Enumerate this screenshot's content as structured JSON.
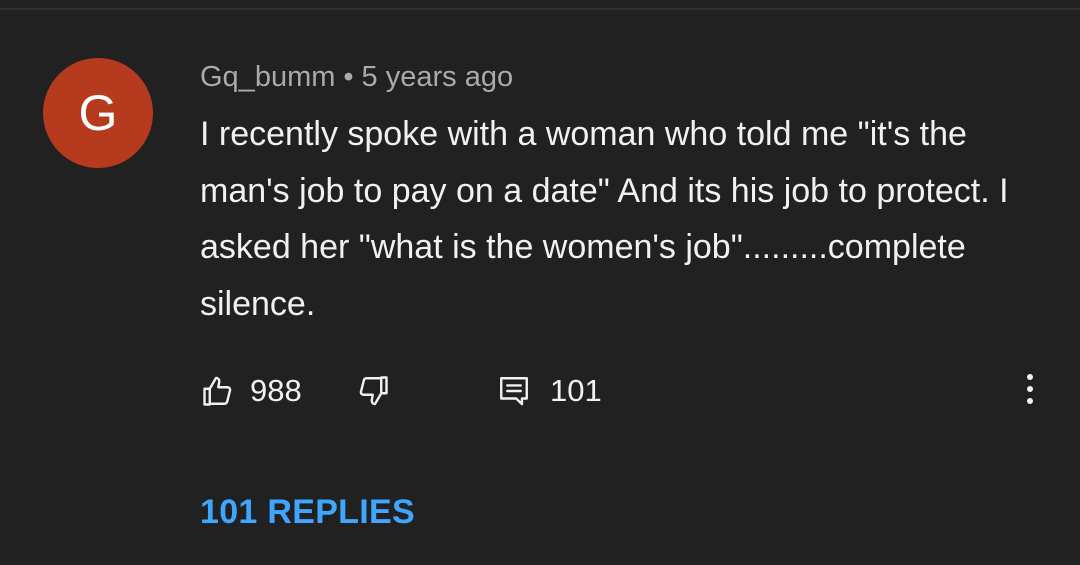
{
  "comment": {
    "avatar_letter": "G",
    "avatar_color": "#b53a1e",
    "author": "Gq_bumm",
    "separator": "•",
    "timestamp": "5 years ago",
    "text": "I recently spoke with a woman who told me \"it's the man's job to pay on a date\" And its his job to protect. I asked her \"what is the women's job\".........complete silence.",
    "actions": {
      "like_icon": "thumbs-up-icon",
      "like_count": "988",
      "dislike_icon": "thumbs-down-icon",
      "reply_icon": "comment-icon",
      "reply_count": "101",
      "more_icon": "more-vertical-icon"
    },
    "replies_label": "101 REPLIES",
    "link_color": "#3ea6ff"
  }
}
